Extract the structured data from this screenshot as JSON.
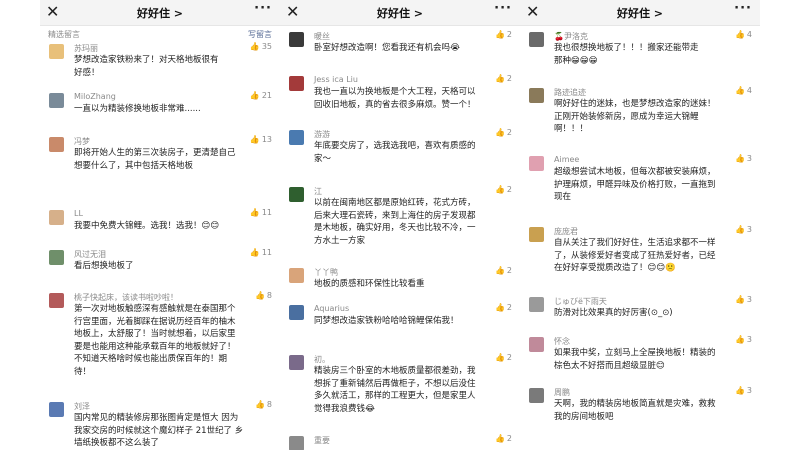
{
  "header_title": "好好住 >",
  "panels": [
    {
      "section_left": "精选留言",
      "section_right": "写留言",
      "comments": [
        {
          "name": "苏玛丽",
          "likes": "35",
          "lines": [
            "梦想改造家铁粉来了！对天格地板很有",
            "好感！"
          ],
          "color": "#e8c07a"
        },
        {
          "name": "MiloZhang",
          "likes": "21",
          "lines": [
            "一直以为精装修换地板非常难......"
          ],
          "color": "#7a8b99"
        },
        {
          "name": "冯梦",
          "likes": "13",
          "lines": [
            "即将开始人生的第三次装房子，更清楚自己",
            "想要什么了，其中包括天格地板"
          ],
          "color": "#c98a6a"
        },
        {
          "name": "LL",
          "likes": "11",
          "lines": [
            "我要中免费大锦鲤。选我！选我！😊😊"
          ],
          "color": "#d6b08a"
        },
        {
          "name": "风过无泪",
          "likes": "11",
          "lines": [
            "看后想换地板了"
          ],
          "color": "#6f8f6a"
        },
        {
          "name": "桃子快起床，该读书啦吵啦！",
          "likes": "8",
          "lines": [
            "第一次对地板触感深有感触就是在泰国那个",
            "行宫里面，光着脚踩在据说历经百年的柚木",
            "地板上，太舒服了！当时就想着，以后家里",
            "要是也能用这种能承载百年的地板就好了！",
            "不知道天格啥时候也能出质保百年的！期",
            "待！"
          ],
          "color": "#b35a5a"
        },
        {
          "name": "刘泽",
          "likes": "8",
          "lines": [
            "国内常见的精装修房那张图肯定是恒大 因为",
            "我家交房的时候就这个魔幻样子 21世纪了 乡",
            "墙纸换板都不这么装了"
          ],
          "color": "#5a7ab3"
        }
      ]
    },
    {
      "comments": [
        {
          "name": "暖丝",
          "likes": "2",
          "lines": [
            "卧室好想改造啊！您看我还有机会吗😭"
          ],
          "color": "#3a3a3a"
        },
        {
          "name": "Jess ica Liu",
          "likes": "2",
          "lines": [
            "我也一直以为换地板是个大工程，天格可以",
            "回收旧地板，真的省去很多麻烦。赞一个！"
          ],
          "color": "#a33a3a"
        },
        {
          "name": "游游",
          "likes": "2",
          "lines": [
            "年底要交房了，选我选我吧，喜欢有质感的",
            "家～"
          ],
          "color": "#4a7ab0"
        },
        {
          "name": "江",
          "likes": "2",
          "lines": [
            "以前在闽南地区都是原始红砖，花式方砖，",
            "后来大理石瓷砖，来到上海住的房子发现都",
            "是木地板，确实好用，冬天也比较不冷，一",
            "方水土一方家"
          ],
          "color": "#2f5f2f"
        },
        {
          "name": "丫丫鸭",
          "likes": "2",
          "lines": [
            "地板的质感和环保性比较看重"
          ],
          "color": "#d9a47a"
        },
        {
          "name": "Aquarius",
          "likes": "2",
          "lines": [
            "同梦想改造家铁粉哈哈哈锦鲤保佑我！"
          ],
          "color": "#4a6fa0"
        },
        {
          "name": "初。",
          "likes": "2",
          "lines": [
            "精装房三个卧室的木地板质量都很差劲，我",
            "想拆了重新铺然后再做柜子，不想以后没住",
            "多久就活工，那样的工程更大，但是家里人",
            "觉得我浪费钱😂"
          ],
          "color": "#7a6a8a"
        },
        {
          "name": "重要",
          "likes": "2",
          "lines": [],
          "color": "#8a8a8a"
        }
      ]
    },
    {
      "comments": [
        {
          "name": "🍒尹洛克",
          "likes": "4",
          "lines": [
            "我也很想换地板了！！！搬家还能带走",
            "那种😁😁😁"
          ],
          "color": "#6a6a6a"
        },
        {
          "name": "路迹追迹",
          "likes": "4",
          "lines": [
            "啊好好住的迷妹，也是梦想改造家的迷妹！",
            "正刚开始装修新房，愿成为幸运大锦鲤",
            "啊！！！"
          ],
          "color": "#8a7a5a"
        },
        {
          "name": "Aimee",
          "likes": "3",
          "lines": [
            "超级想尝试木地板，但每次都被安装麻烦，",
            "护理麻烦，甲醛异味及价格打败，一直拖到",
            "现在"
          ],
          "color": "#e0a0b0"
        },
        {
          "name": "庞庞君",
          "likes": "3",
          "lines": [
            "自从关注了我们好好住，生活追求都不一样",
            "了，从装修爱好者变成了狂热爱好者，已经",
            "在好好享受搅质改造了！😊😊🙁"
          ],
          "color": "#c9a050"
        },
        {
          "name": "じゅびё下雨天",
          "likes": "3",
          "lines": [
            "防滑对比效果真的好厉害(⊙_⊙)"
          ],
          "color": "#9a9a9a"
        },
        {
          "name": "怀念",
          "likes": "3",
          "lines": [
            "如果我中奖，立刻马上全屋换地板！精装的",
            "棕色太不好搭而且超级显脏😊"
          ],
          "color": "#c08a9a"
        },
        {
          "name": "周鹏",
          "likes": "3",
          "lines": [
            "天啊，我的精装房地板简直就是灾难，救救",
            "我的房间地板吧"
          ],
          "color": "#7a7a7a"
        }
      ]
    }
  ]
}
